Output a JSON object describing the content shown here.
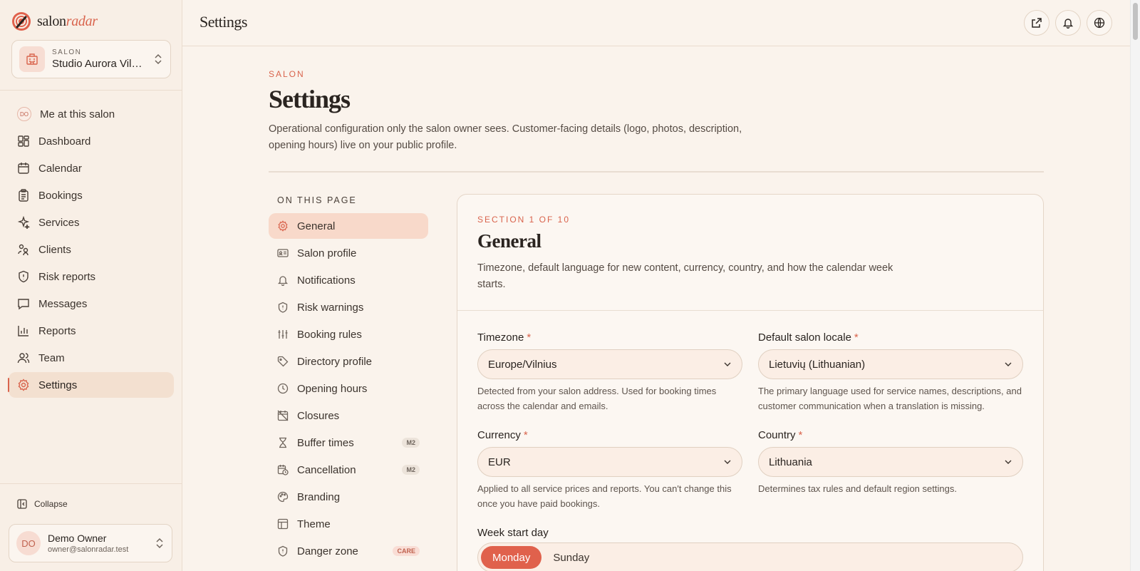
{
  "brand": {
    "name_a": "salon",
    "name_b": "radar"
  },
  "salon_switcher": {
    "kicker": "SALON",
    "name": "Studio Aurora Vilnius"
  },
  "sidebar": {
    "me_initials": "DO",
    "items": [
      {
        "label": "Me at this salon",
        "icon": "me-badge"
      },
      {
        "label": "Dashboard",
        "icon": "grid-icon"
      },
      {
        "label": "Calendar",
        "icon": "calendar-icon"
      },
      {
        "label": "Bookings",
        "icon": "clipboard-icon"
      },
      {
        "label": "Services",
        "icon": "sparkles-icon"
      },
      {
        "label": "Clients",
        "icon": "clients-icon"
      },
      {
        "label": "Risk reports",
        "icon": "shield-icon"
      },
      {
        "label": "Messages",
        "icon": "message-icon"
      },
      {
        "label": "Reports",
        "icon": "bar-chart-icon"
      },
      {
        "label": "Team",
        "icon": "team-icon"
      },
      {
        "label": "Settings",
        "icon": "gear-icon",
        "active": true
      }
    ],
    "collapse_label": "Collapse",
    "user": {
      "initials": "DO",
      "name": "Demo Owner",
      "email": "owner@salonradar.test"
    }
  },
  "topbar": {
    "title": "Settings"
  },
  "page": {
    "kicker": "SALON",
    "title": "Settings",
    "description": "Operational configuration only the salon owner sees. Customer-facing details (logo, photos, description, opening hours) live on your public profile."
  },
  "toc": {
    "heading": "ON THIS PAGE",
    "items": [
      {
        "label": "General",
        "icon": "gear-icon",
        "active": true
      },
      {
        "label": "Salon profile",
        "icon": "id-card-icon"
      },
      {
        "label": "Notifications",
        "icon": "bell-icon"
      },
      {
        "label": "Risk warnings",
        "icon": "shield-alert-icon"
      },
      {
        "label": "Booking rules",
        "icon": "sliders-icon"
      },
      {
        "label": "Directory profile",
        "icon": "tag-icon"
      },
      {
        "label": "Opening hours",
        "icon": "clock-icon"
      },
      {
        "label": "Closures",
        "icon": "calendar-off-icon"
      },
      {
        "label": "Buffer times",
        "icon": "hourglass-icon",
        "badge": "M2"
      },
      {
        "label": "Cancellation",
        "icon": "calendar-clock-icon",
        "badge": "M2"
      },
      {
        "label": "Branding",
        "icon": "palette-icon"
      },
      {
        "label": "Theme",
        "icon": "layout-icon"
      },
      {
        "label": "Danger zone",
        "icon": "shield-warning-icon",
        "badge": "CARE"
      }
    ]
  },
  "section": {
    "kicker": "SECTION 1 OF 10",
    "title": "General",
    "description": "Timezone, default language for new content, currency, country, and how the calendar week starts.",
    "fields": {
      "timezone": {
        "label": "Timezone",
        "required": "*",
        "value": "Europe/Vilnius",
        "help": "Detected from your salon address. Used for booking times across the calendar and emails."
      },
      "locale": {
        "label": "Default salon locale",
        "required": "*",
        "value": "Lietuvių (Lithuanian)",
        "help": "The primary language used for service names, descriptions, and customer communication when a translation is missing."
      },
      "currency": {
        "label": "Currency",
        "required": "*",
        "value": "EUR",
        "help": "Applied to all service prices and reports. You can't change this once you have paid bookings."
      },
      "country": {
        "label": "Country",
        "required": "*",
        "value": "Lithuania",
        "help": "Determines tax rules and default region settings."
      }
    },
    "week_start": {
      "label": "Week start day",
      "options": [
        "Monday",
        "Sunday"
      ],
      "selected": "Monday"
    }
  },
  "colors": {
    "accent": "#d9644d",
    "background": "#faf3ec",
    "sidebar": "#f8efe6",
    "active_toc": "#f8d9ca"
  }
}
